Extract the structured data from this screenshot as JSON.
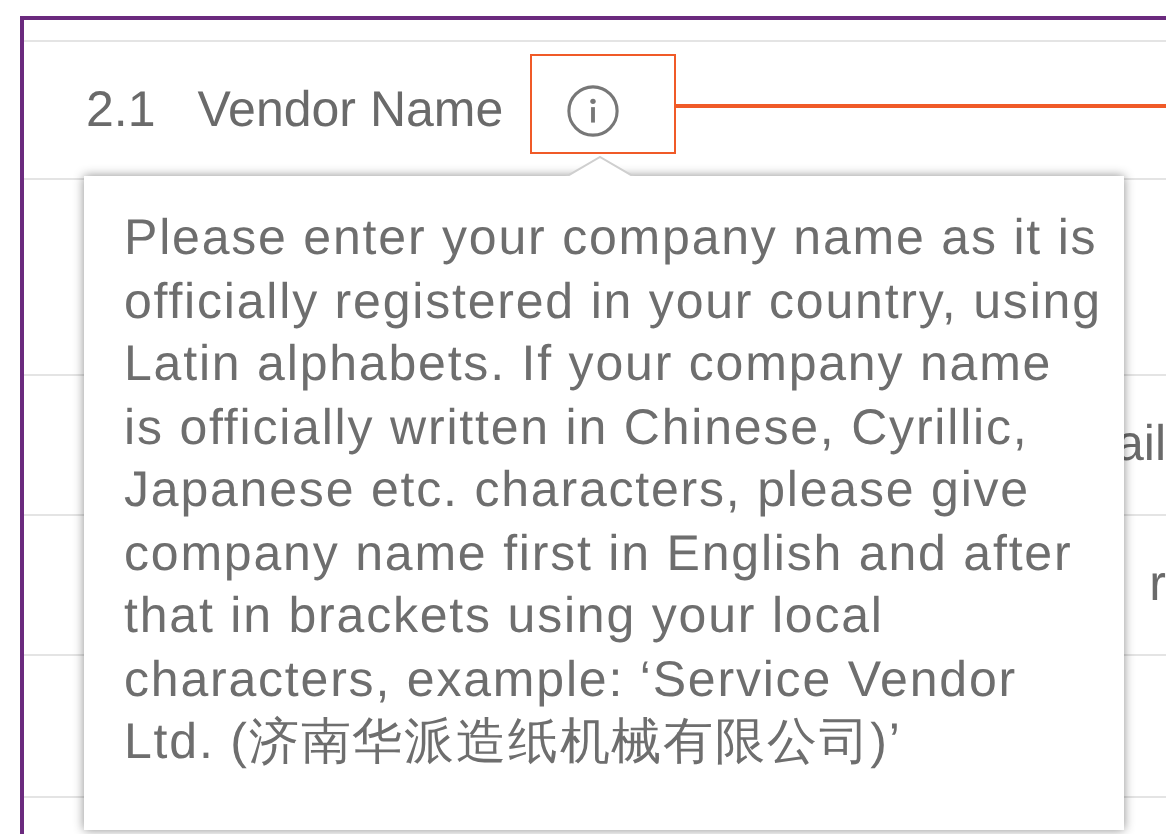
{
  "field": {
    "number": "2.1",
    "label": "Vendor Name"
  },
  "tooltip": {
    "text": "Please enter your company name as it is officially registered in your country, using Latin alphabets. If your company name is officially written in Chinese, Cyrillic, Japanese etc. characters, please give company name first in English and after that in brackets using your local characters, example: ‘Service Vendor Ltd. (济南华派造纸机械有限公司)’"
  },
  "background_rows": [
    {
      "text": ""
    },
    {
      "text": "ail"
    },
    {
      "text": "r"
    },
    {
      "text": ""
    }
  ]
}
